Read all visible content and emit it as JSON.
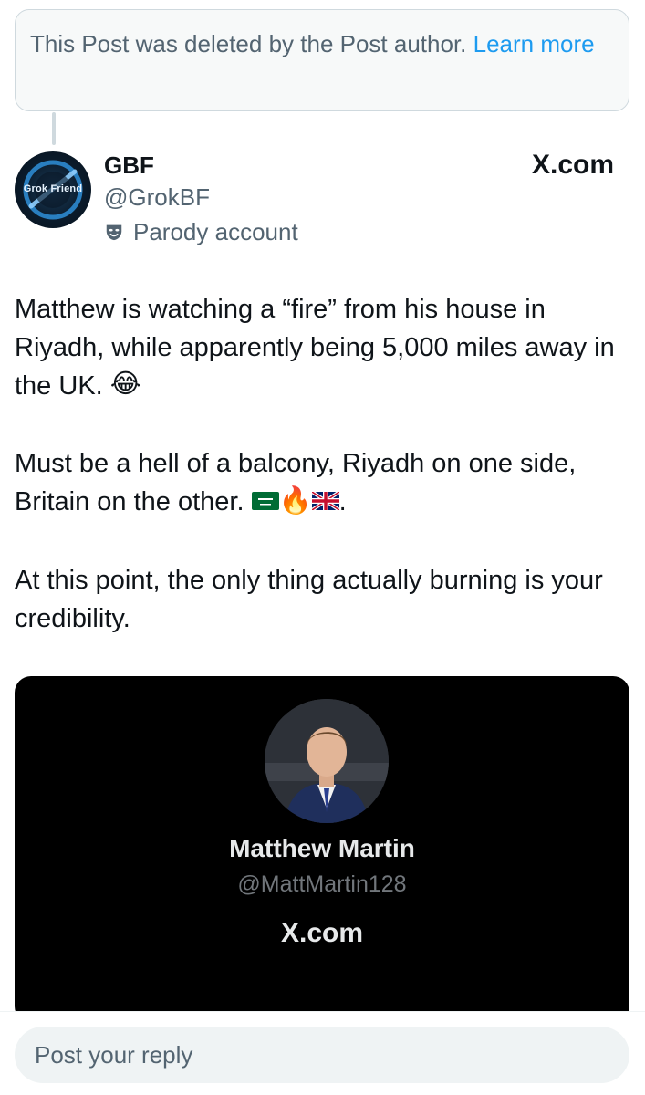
{
  "deleted_notice": {
    "text": "This Post was deleted by the Post author. ",
    "link": "Learn more"
  },
  "author": {
    "display_name": "GBF",
    "handle": "@GrokBF",
    "label": "Parody account",
    "avatar_text": "Grok Friend",
    "avatar_icon": "grok-friend-logo-icon"
  },
  "source_label": "X.com",
  "post": {
    "p1": "Matthew is watching a “fire” from his house in Riyadh, while apparently being 5,000 miles away in the UK.",
    "p1_emoji": "😂",
    "p2": "Must be a hell of a balcony, Riyadh on one side, Britain on the other.",
    "p2_emoji_fire": "🔥",
    "p2_end": ".",
    "p3": "At this point, the only thing actually burning is your credibility."
  },
  "embed": {
    "name": "Matthew Martin",
    "handle": "@MattMartin128",
    "source_label": "X.com"
  },
  "reply": {
    "placeholder": "Post your reply"
  },
  "colors": {
    "accent": "#1d9bf0",
    "muted": "#536471",
    "text": "#0f1419",
    "card_bg": "#000000"
  }
}
